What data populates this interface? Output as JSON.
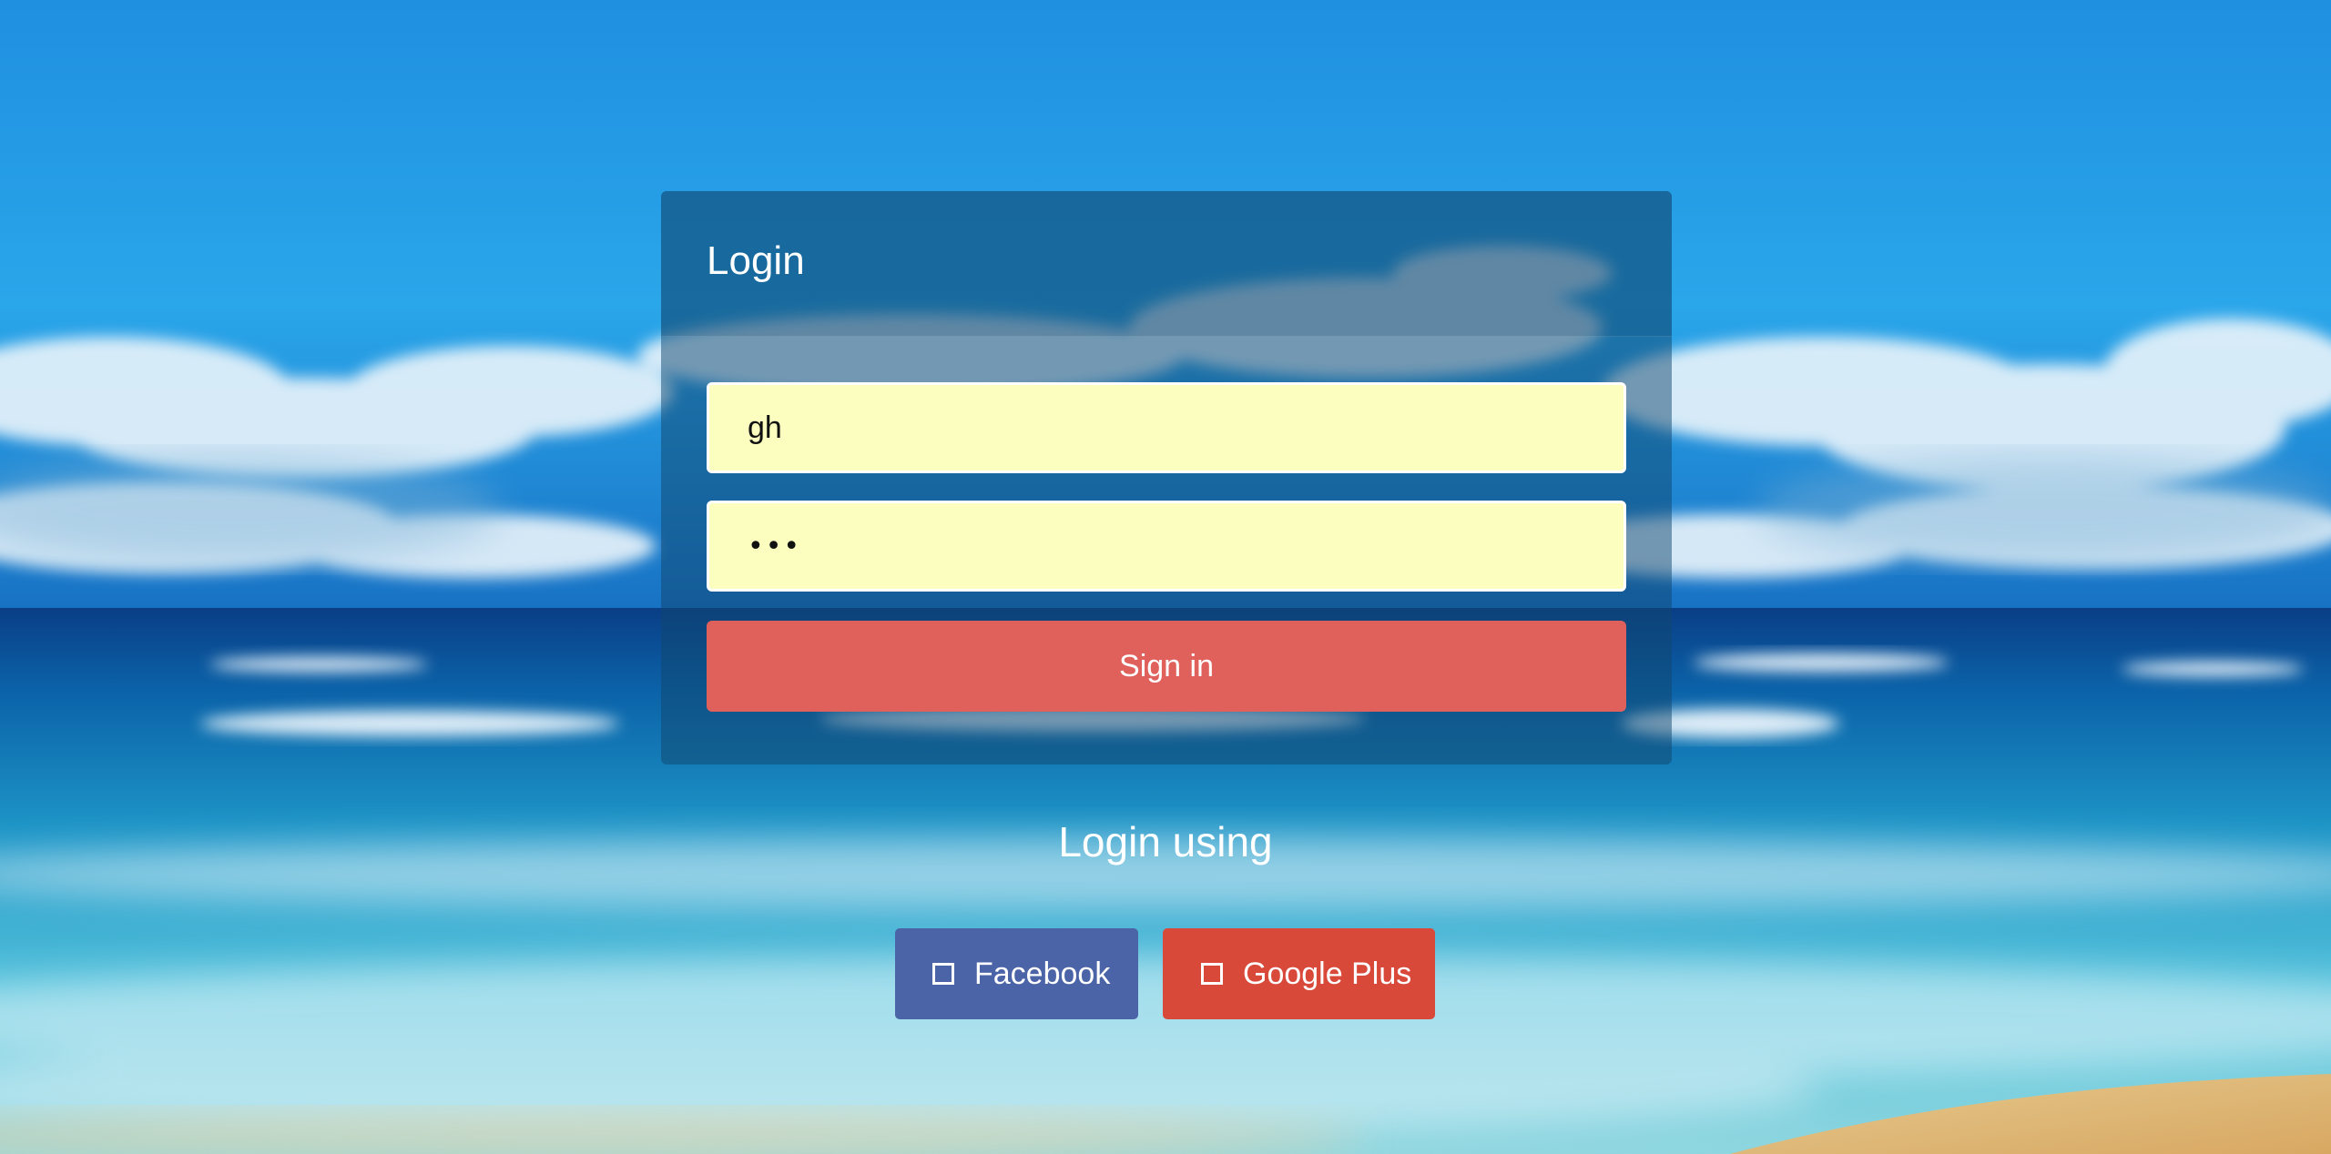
{
  "login": {
    "title": "Login",
    "username_value": "gh",
    "password_value": "•••",
    "signin_label": "Sign in"
  },
  "social": {
    "heading": "Login using",
    "facebook_label": "Facebook",
    "google_label": "Google Plus",
    "facebook_icon": "square-icon",
    "google_icon": "square-icon"
  },
  "colors": {
    "signin": "#e0615c",
    "facebook": "#4a64a7",
    "google": "#d9493a",
    "field_bg": "#fbfebe"
  }
}
